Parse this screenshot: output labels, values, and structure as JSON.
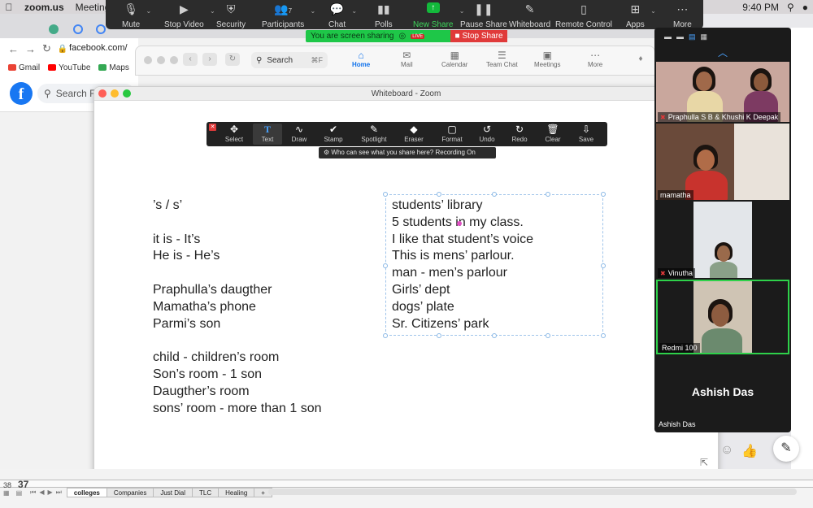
{
  "menubar": {
    "app_name": "zoom.us",
    "meeting_label": "Meeting",
    "time": "9:40 PM"
  },
  "zoom_toolbar": {
    "items": [
      {
        "label": "Mute",
        "icon": "microphone-icon"
      },
      {
        "label": "Stop Video",
        "icon": "video-camera-icon"
      },
      {
        "label": "Security",
        "icon": "shield-icon"
      },
      {
        "label": "Participants",
        "icon": "participants-icon",
        "count": "7"
      },
      {
        "label": "Chat",
        "icon": "chat-bubble-icon"
      },
      {
        "label": "Polls",
        "icon": "bar-chart-icon"
      },
      {
        "label": "New Share",
        "icon": "share-arrow-icon"
      },
      {
        "label": "Pause Share",
        "icon": "pause-icon"
      },
      {
        "label": "Whiteboard",
        "icon": "pen-icon"
      },
      {
        "label": "Remote Control",
        "icon": "mouse-icon"
      },
      {
        "label": "Apps",
        "icon": "apps-icon"
      },
      {
        "label": "More",
        "icon": "ellipsis-icon"
      }
    ],
    "sharing_text": "You are screen sharing",
    "live_badge": "LIVE",
    "stop_share": "Stop Share",
    "accent_green": "#1ec748",
    "stop_red": "#e03a3a"
  },
  "browser": {
    "address": "facebook.com/",
    "bookmarks": [
      "Gmail",
      "YouTube",
      "Maps"
    ],
    "fb_search_placeholder": "Search Fa"
  },
  "zoom_main": {
    "search_placeholder": "Search",
    "search_shortcut": "⌘F",
    "tabs": [
      {
        "label": "Home",
        "active": true
      },
      {
        "label": "Mail"
      },
      {
        "label": "Calendar"
      },
      {
        "label": "Team Chat"
      },
      {
        "label": "Meetings"
      },
      {
        "label": "More"
      }
    ]
  },
  "whiteboard": {
    "title": "Whiteboard - Zoom",
    "tools": [
      "Select",
      "Text",
      "Draw",
      "Stamp",
      "Spotlight",
      "Eraser",
      "Format",
      "Undo",
      "Redo",
      "Clear",
      "Save"
    ],
    "active_tool": "Text",
    "recording_banner": "Who can see what you share here? Recording On",
    "left_text": [
      "’s / s’",
      "",
      "it is  - It’s",
      "He is - He’s",
      "",
      "Praphulla’s daugther",
      "Mamatha’s phone",
      "Parmi’s  son",
      "",
      "child - children’s room",
      "Son’s  room - 1 son",
      "Daugther’s room",
      "sons’ room - more than 1 son"
    ],
    "right_text": [
      "students’ library",
      "5 students in my class.",
      "I like that student’s voice",
      "This is mens’ parlour.",
      "man - men’s parlour",
      "Girls’ dept",
      "dogs’ plate",
      "Sr. Citizens’ park"
    ]
  },
  "participants": {
    "tiles": [
      {
        "name": "Praphulla S B & Khushi K Deepak",
        "muted": true
      },
      {
        "name": "mamatha",
        "muted": false
      },
      {
        "name": "Vinutha",
        "muted": true
      },
      {
        "name": "Redmi 100",
        "muted": false,
        "active_speaker": true
      }
    ],
    "no_video_name": "Ashish Das",
    "no_video_label": "Ashish Das"
  },
  "spreadsheet": {
    "row_numbers": [
      "38",
      "37"
    ],
    "tabs": [
      "colleges",
      "Companies",
      "Just Dial",
      "TLC",
      "Healing"
    ],
    "active_tab": "colleges",
    "add_tab": "+"
  }
}
